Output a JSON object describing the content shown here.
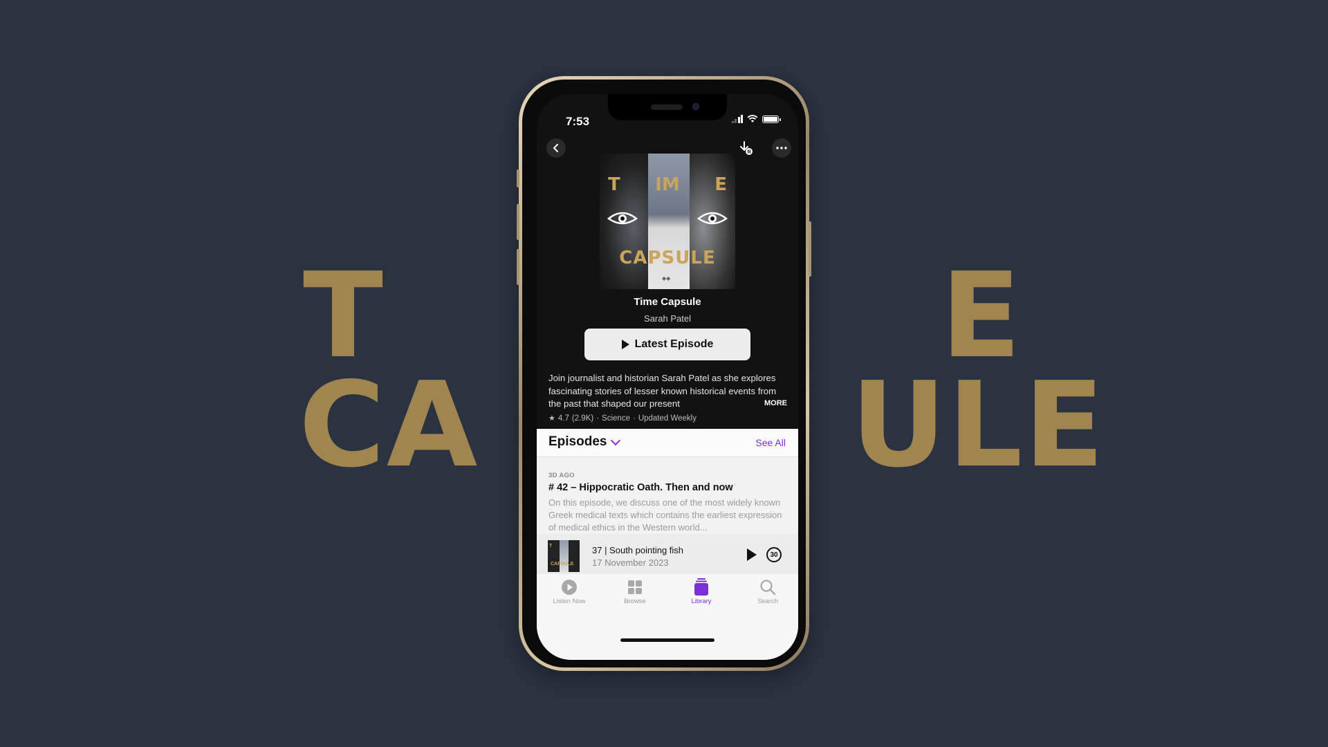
{
  "background": {
    "words": [
      "T",
      "E",
      "CA",
      "ULE"
    ],
    "colors": {
      "bg": "#2b3240",
      "gold": "#a08550"
    }
  },
  "status_bar": {
    "time": "7:53"
  },
  "nav": {
    "back_icon": "chevron-left-icon",
    "download_icon": "download-paused-icon",
    "more_icon": "ellipsis-icon"
  },
  "artwork": {
    "line1": [
      "T",
      "IM",
      "E"
    ],
    "line2": "CAPSULE"
  },
  "podcast": {
    "title": "Time Capsule",
    "author": "Sarah Patel",
    "play_button": "Latest Episode",
    "description": "Join journalist and historian Sarah Patel as she explores fascinating stories of lesser known historical events from the past that shaped our present",
    "more_label": "MORE",
    "rating": "4.7",
    "rating_count": "(2.9K)",
    "category": "Science",
    "frequency": "Updated Weekly"
  },
  "episodes": {
    "header": "Episodes",
    "see_all": "See All",
    "items": [
      {
        "date": "3D AGO",
        "title": "# 42 – Hippocratic Oath. Then and now",
        "description": "On this episode, we discuss one of the most widely known Greek medical texts which contains the earliest expression of medical ethics in the Western world..."
      }
    ]
  },
  "mini_player": {
    "title": "37 | South pointing fish",
    "date": "17 November 2023",
    "skip_label": "30"
  },
  "tabs": [
    {
      "label": "Listen Now",
      "icon": "play-circle-icon",
      "active": false
    },
    {
      "label": "Browse",
      "icon": "grid-icon",
      "active": false
    },
    {
      "label": "Library",
      "icon": "library-icon",
      "active": true
    },
    {
      "label": "Search",
      "icon": "search-icon",
      "active": false
    }
  ],
  "accent_color": "#7b2fd6"
}
